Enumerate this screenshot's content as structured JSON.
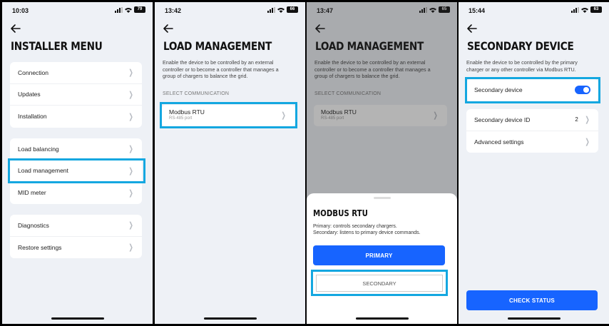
{
  "colors": {
    "accent": "#1764ff",
    "highlight": "#14a7e0",
    "background": "#eef1f6"
  },
  "screen1": {
    "time": "10:03",
    "battery": "79",
    "title": "INSTALLER MENU",
    "group1": [
      "Connection",
      "Updates",
      "Installation"
    ],
    "group2": [
      "Load balancing",
      "Load management",
      "MID meter"
    ],
    "group3": [
      "Diagnostics",
      "Restore settings"
    ]
  },
  "screen2": {
    "time": "13:42",
    "battery": "66",
    "title": "LOAD MANAGEMENT",
    "description": "Enable the device to be controlled by an external controller or to become a controller that manages a group of chargers to balance the grid.",
    "section": "SELECT COMMUNICATION",
    "option_title": "Modbus RTU",
    "option_sub": "RS-485 port"
  },
  "screen3": {
    "time": "13:47",
    "battery": "65",
    "title": "LOAD MANAGEMENT",
    "description": "Enable the device to be controlled by an external controller or to become a controller that manages a group of chargers to balance the grid.",
    "section": "SELECT COMMUNICATION",
    "option_title": "Modbus RTU",
    "option_sub": "RS-485 port",
    "sheet_title": "MODBUS RTU",
    "sheet_line1": "Primary: controls secondary chargers.",
    "sheet_line2": "Secondary: listens to primary device commands.",
    "primary_label": "PRIMARY",
    "secondary_label": "SECONDARY"
  },
  "screen4": {
    "time": "15:44",
    "battery": "63",
    "title": "SECONDARY DEVICE",
    "description": "Enable the device to be controlled by the primary charger or any other controller via Modbus RTU.",
    "toggle_label": "Secondary device",
    "toggle_on": true,
    "device_id_label": "Secondary device ID",
    "device_id_value": "2",
    "advanced_label": "Advanced settings",
    "check_status_label": "CHECK STATUS"
  }
}
